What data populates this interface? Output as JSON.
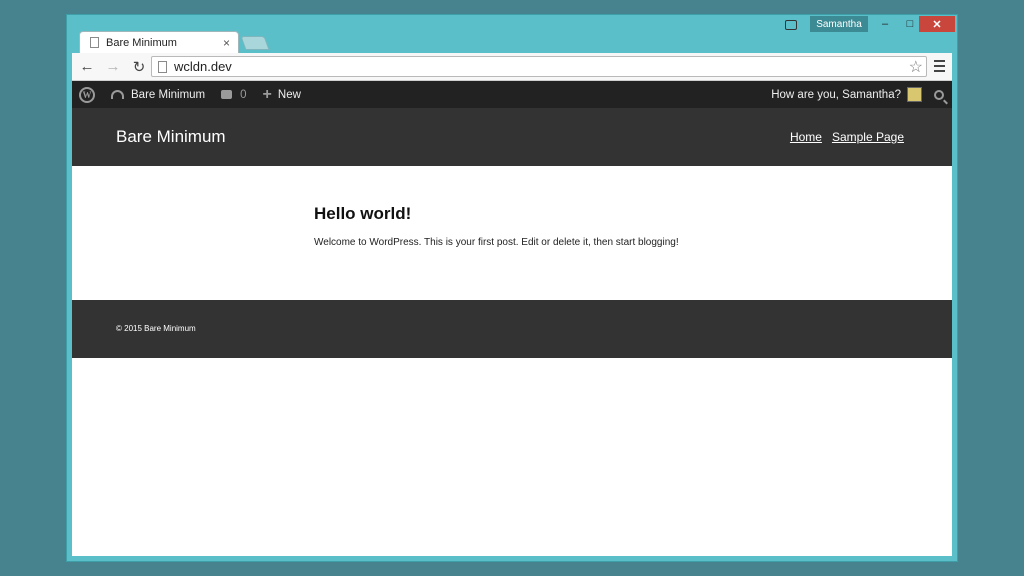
{
  "browser": {
    "tab_title": "Bare Minimum",
    "tab_close": "×",
    "user_name": "Samantha",
    "minimize": "–",
    "maximize": "□",
    "close": "✕",
    "url": "wcldn.dev",
    "back": "←",
    "forward": "→",
    "reload": "↻",
    "star": "☆"
  },
  "adminbar": {
    "site_name": "Bare Minimum",
    "comment_count": "0",
    "new_label": "New",
    "greeting": "How are you, Samantha?"
  },
  "site": {
    "title": "Bare Minimum",
    "nav": [
      "Home",
      "Sample Page"
    ]
  },
  "post": {
    "title": "Hello world!",
    "body": "Welcome to WordPress. This is your first post. Edit or delete it, then start blogging!"
  },
  "footer": {
    "text": "© 2015 Bare Minimum"
  },
  "colors": {
    "desktop": "#46838f",
    "window_frame": "#5bbfca",
    "admin_bar": "#222222",
    "site_header": "#333333",
    "close_button": "#c9463d"
  }
}
